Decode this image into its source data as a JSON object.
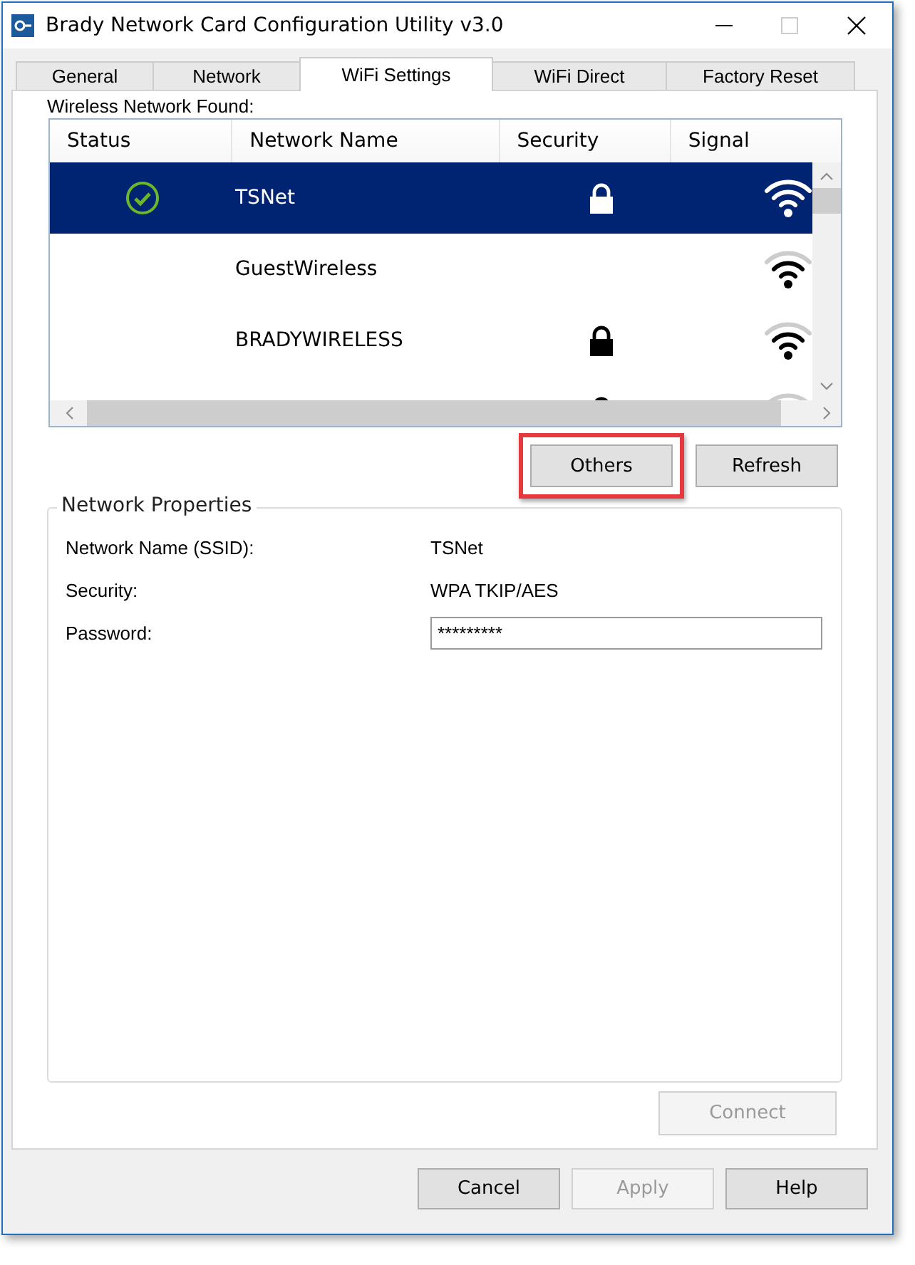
{
  "window": {
    "title": "Brady Network Card Configuration Utility v3.0"
  },
  "tabs": [
    {
      "label": "General",
      "selected": false
    },
    {
      "label": "Network",
      "selected": false
    },
    {
      "label": "WiFi Settings",
      "selected": true
    },
    {
      "label": "WiFi Direct",
      "selected": false
    },
    {
      "label": "Factory Reset",
      "selected": false
    }
  ],
  "networks": {
    "label": "Wireless Network Found:",
    "columns": [
      "Status",
      "Network Name",
      "Security",
      "Signal"
    ],
    "rows": [
      {
        "name": "TSNet",
        "connected": true,
        "secured": true,
        "selected": true
      },
      {
        "name": "GuestWireless",
        "connected": false,
        "secured": false,
        "selected": false
      },
      {
        "name": "BRADYWIRELESS",
        "connected": false,
        "secured": true,
        "selected": false
      },
      {
        "connected": false,
        "secured": true,
        "selected": false
      }
    ]
  },
  "list_buttons": [
    {
      "label": "Others",
      "highlighted": true
    },
    {
      "label": "Refresh",
      "highlighted": false
    }
  ],
  "properties": {
    "title": "Network Properties",
    "fields": [
      {
        "kind": "text",
        "label": "Network Name (SSID):",
        "value": "TSNet"
      },
      {
        "kind": "text",
        "label": "Security:",
        "value": "WPA TKIP/AES"
      },
      {
        "kind": "input",
        "label": "Password:",
        "value": "*********"
      }
    ],
    "connect": {
      "label": "Connect",
      "disabled": true
    }
  },
  "buttons": [
    {
      "label": "Cancel",
      "disabled": false
    },
    {
      "label": "Apply",
      "disabled": true
    },
    {
      "label": "Help",
      "disabled": false
    }
  ]
}
